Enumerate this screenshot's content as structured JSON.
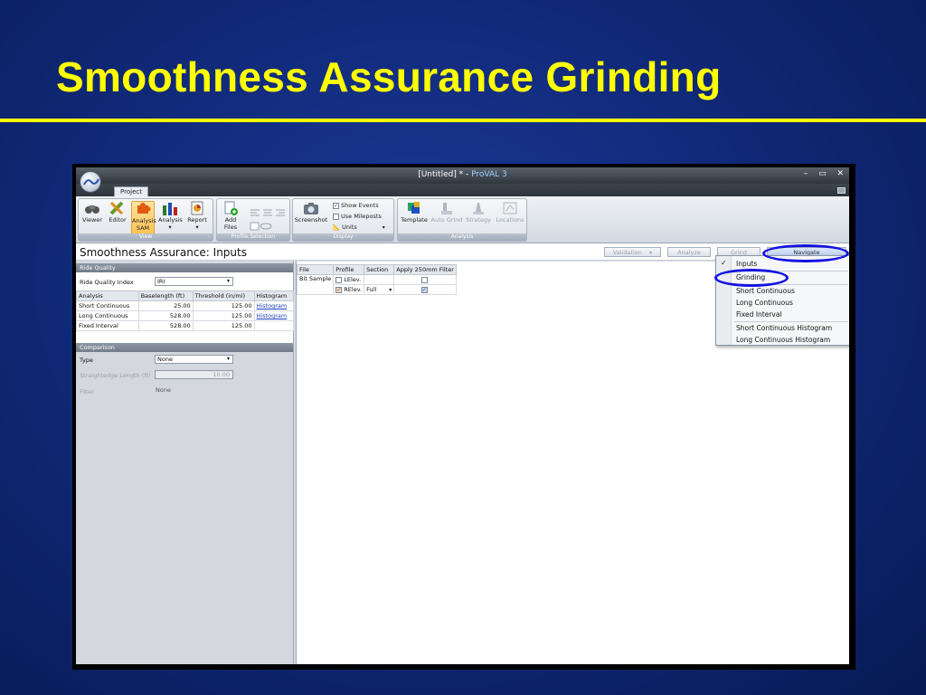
{
  "slide": {
    "title": "Smoothness Assurance Grinding"
  },
  "window": {
    "title_doc": "[Untitled] * - ",
    "title_app": "ProVAL 3",
    "btn_min": "–",
    "btn_max": "▭",
    "btn_close": "✕",
    "tab": "Project"
  },
  "ribbon": {
    "view_group": "View",
    "buttons_view": [
      {
        "label": "Viewer"
      },
      {
        "label": "Editor"
      },
      {
        "label": "Analysis SAM"
      },
      {
        "label": "Analysis ▾"
      },
      {
        "label": "Report ▾"
      }
    ],
    "profile_group": "Profile Selection",
    "add_files": "Add Files",
    "screenshot": "Screenshot",
    "display_group": "Display",
    "show_events": "Show Events",
    "use_mileposts": "Use Mileposts",
    "units": "Units",
    "analysis_group": "Analysis",
    "template": "Template",
    "auto_grind": "Auto Grind",
    "strategy": "Strategy",
    "locations": "Locations"
  },
  "header": {
    "title": "Smoothness Assurance: Inputs",
    "validation": "Validation",
    "analyze": "Analyze",
    "grind": "Grind",
    "navigate": "Navigate"
  },
  "ride_quality": {
    "heading": "Ride Quality",
    "index_label": "Ride Quality Index",
    "index_value": "IRI",
    "columns": [
      "Analysis",
      "Baselength (ft)",
      "Threshold (in/mi)",
      "Histogram"
    ],
    "rows": [
      {
        "analysis": "Short Continuous",
        "baselength": "25.00",
        "threshold": "125.00",
        "histogram": "Histogram"
      },
      {
        "analysis": "Long Continuous",
        "baselength": "528.00",
        "threshold": "125.00",
        "histogram": "Histogram"
      },
      {
        "analysis": "Fixed Interval",
        "baselength": "528.00",
        "threshold": "125.00",
        "histogram": ""
      }
    ]
  },
  "comparison": {
    "heading": "Comparison",
    "type_label": "Type",
    "type_value": "None",
    "straightedge_label": "Straightedge Length (ft)",
    "straightedge_value": "10.00",
    "filter_label": "Filter",
    "filter_value": "None"
  },
  "files": {
    "columns": [
      "File",
      "Profile",
      "Section",
      "Apply 250mm Filter"
    ],
    "file_name": "Bit Sample",
    "rows": [
      {
        "profile": "LElev.",
        "section": "",
        "checked": false,
        "filter": false
      },
      {
        "profile": "RElev.",
        "section": "Full",
        "checked": true,
        "filter": true
      }
    ]
  },
  "nav_menu": {
    "items": [
      "Inputs",
      "Grinding",
      "Short Continuous",
      "Long Continuous",
      "Fixed Interval",
      "Short Continuous Histogram",
      "Long Continuous Histogram"
    ],
    "checked": "Inputs"
  },
  "colors": {
    "title_yellow": "#ffff00",
    "highlight_oval": "#1414e0",
    "slide_bg": "#112a7a"
  }
}
